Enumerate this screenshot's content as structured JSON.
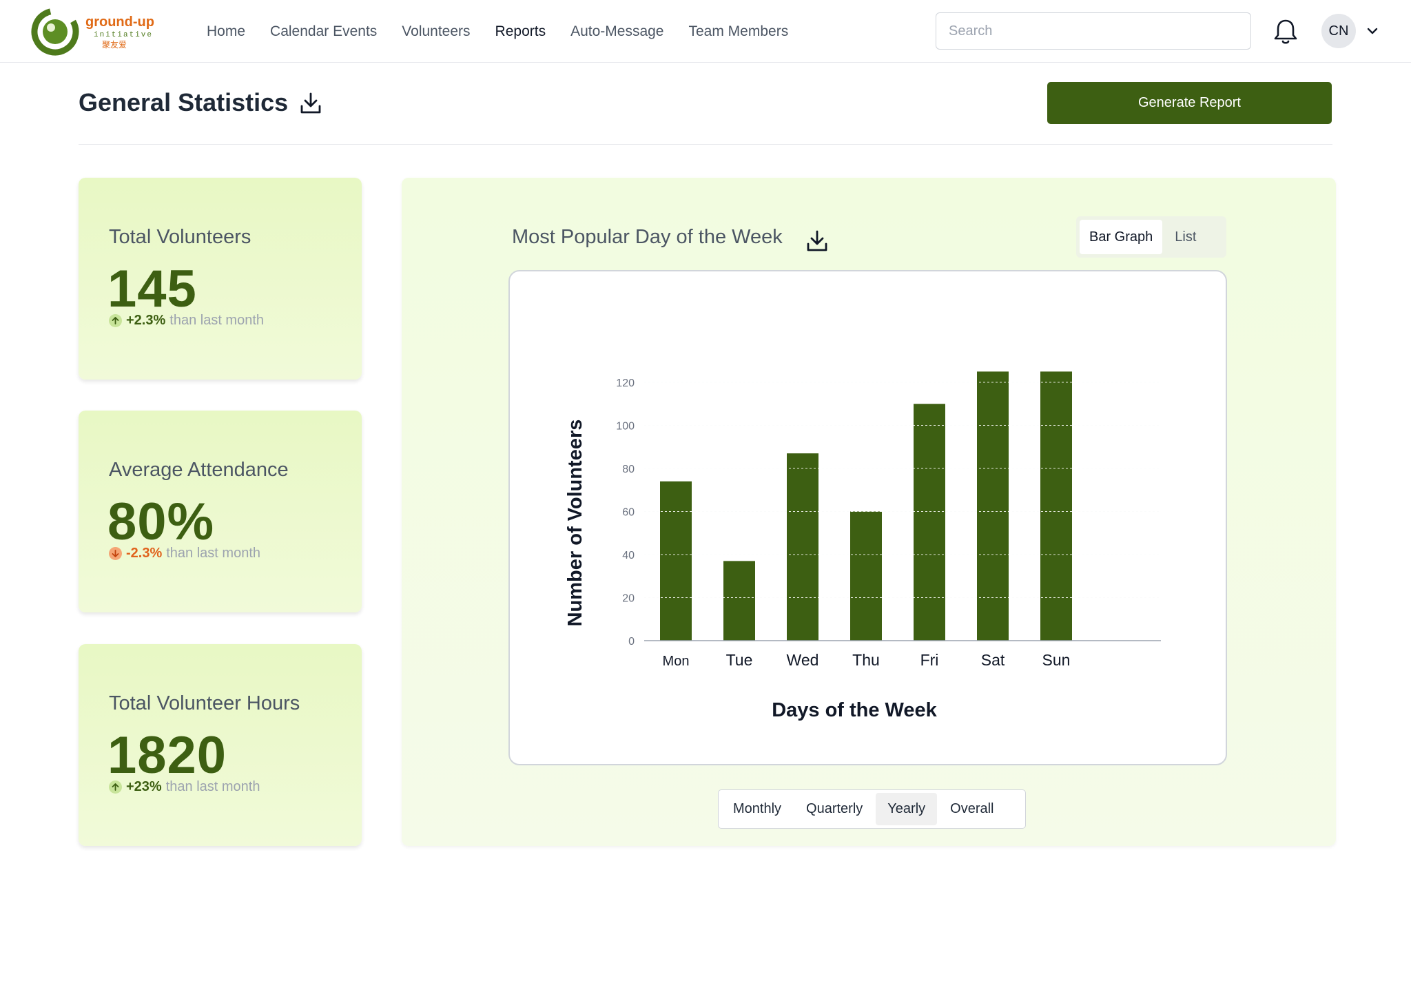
{
  "header": {
    "logo_text": "ground-up",
    "logo_sub": "initiative",
    "logo_cn": "聚友爱",
    "nav": [
      {
        "label": "Home"
      },
      {
        "label": "Calendar Events"
      },
      {
        "label": "Volunteers"
      },
      {
        "label": "Reports",
        "active": true
      },
      {
        "label": "Auto-Message"
      },
      {
        "label": "Team Members"
      }
    ],
    "search_placeholder": "Search",
    "avatar_initials": "CN"
  },
  "page": {
    "title": "General Statistics",
    "generate_label": "Generate Report"
  },
  "stats": [
    {
      "title": "Total Volunteers",
      "value": "145",
      "change": "+2.3%",
      "direction": "up",
      "suffix": "than last month"
    },
    {
      "title": "Average Attendance",
      "value": "80%",
      "change": "-2.3%",
      "direction": "down",
      "suffix": "than last month"
    },
    {
      "title": "Total Volunteer Hours",
      "value": "1820",
      "change": "+23%",
      "direction": "up",
      "suffix": "than last month"
    }
  ],
  "chart_panel": {
    "title": "Most Popular Day of the Week",
    "views": [
      "Bar Graph",
      "List"
    ],
    "selected_view": "Bar Graph",
    "periods": [
      "Monthly",
      "Quarterly",
      "Yearly",
      "Overall"
    ],
    "selected_period": "Yearly"
  },
  "colors": {
    "brand_green": "#3d5f12",
    "card_bg": "#e8f8c4",
    "down_orange": "#e0621c"
  },
  "chart_data": {
    "type": "bar",
    "categories": [
      "Mon",
      "Tue",
      "Wed",
      "Thu",
      "Fri",
      "Sat",
      "Sun"
    ],
    "values": [
      74,
      37,
      87,
      60,
      110,
      125,
      125
    ],
    "xlabel": "Days of the Week",
    "ylabel": "Number of Volunteers",
    "ylim": [
      0,
      120
    ],
    "yticks": [
      0,
      20,
      40,
      60,
      80,
      100,
      120
    ],
    "grid": true
  }
}
